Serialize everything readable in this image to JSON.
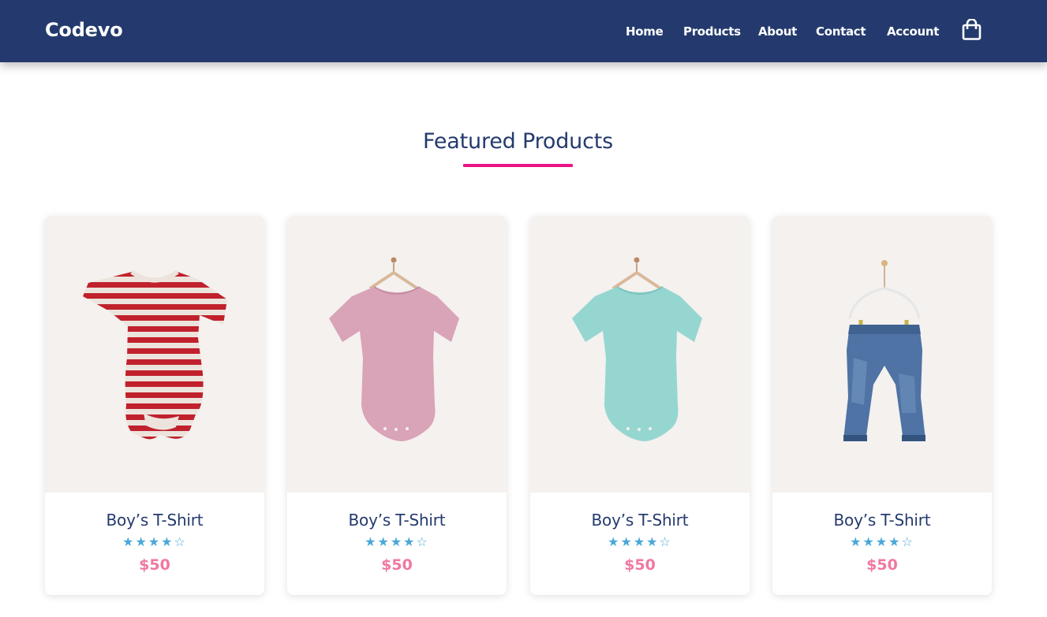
{
  "header": {
    "logo": "Codevo",
    "nav": [
      {
        "label": "Home"
      },
      {
        "label": "Products"
      },
      {
        "label": "About"
      },
      {
        "label": "Contact"
      },
      {
        "label": "Account"
      }
    ],
    "cart_icon": "shopping-bag-icon"
  },
  "featured": {
    "title": "Featured Products",
    "accent_color": "#ea1386",
    "products": [
      {
        "name": "Boy’s T-Shirt",
        "rating": 4,
        "rating_max": 5,
        "stars": "★★★★☆",
        "price": "$50",
        "image": "red-striped-baby-bodysuit"
      },
      {
        "name": "Boy’s T-Shirt",
        "rating": 4,
        "rating_max": 5,
        "stars": "★★★★☆",
        "price": "$50",
        "image": "pink-baby-bodysuit-on-hanger"
      },
      {
        "name": "Boy’s T-Shirt",
        "rating": 4,
        "rating_max": 5,
        "stars": "★★★★☆",
        "price": "$50",
        "image": "teal-baby-bodysuit-on-hanger"
      },
      {
        "name": "Boy’s T-Shirt",
        "rating": 4,
        "rating_max": 5,
        "stars": "★★★★☆",
        "price": "$50",
        "image": "denim-dungarees-on-hanger"
      }
    ]
  },
  "colors": {
    "navbar": "#243a6e",
    "heading": "#243a6e",
    "star": "#4aa8d8",
    "price": "#f0789f"
  }
}
